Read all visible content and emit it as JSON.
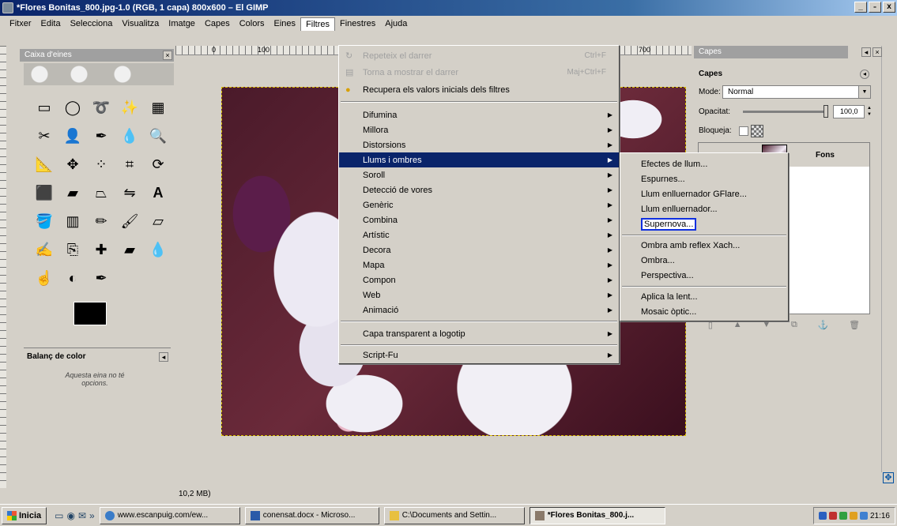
{
  "window": {
    "title": "*Flores Bonitas_800.jpg-1.0 (RGB, 1 capa) 800x600 – El GIMP",
    "buttons": [
      "_",
      "̵",
      "x"
    ]
  },
  "menubar": [
    "Fitxer",
    "Edita",
    "Selecciona",
    "Visualitza",
    "Imatge",
    "Capes",
    "Colors",
    "Eines",
    "Filtres",
    "Finestres",
    "Ajuda"
  ],
  "toolbox": {
    "tab_label": "Caixa d'eines",
    "balance_title": "Balanç de color",
    "balance_text": "Aquesta eina no té opcions."
  },
  "rulers": [
    "0",
    "100",
    "700"
  ],
  "statusbar": "10,2 MB)",
  "filters_menu": {
    "items": [
      {
        "label": "Repeteix el darrer",
        "shortcut": "Ctrl+F",
        "disabled": true
      },
      {
        "label": "Torna a mostrar el darrer",
        "shortcut": "Maj+Ctrl+F",
        "disabled": true
      },
      {
        "label": "Recupera els valors inicials dels filtres",
        "disabled": false
      },
      {
        "label": "Difumina",
        "sub": true
      },
      {
        "label": "Millora",
        "sub": true
      },
      {
        "label": "Distorsions",
        "sub": true
      },
      {
        "label": "Llums i ombres",
        "sub": true,
        "active": true
      },
      {
        "label": "Soroll",
        "sub": true
      },
      {
        "label": "Detecció de vores",
        "sub": true
      },
      {
        "label": "Genèric",
        "sub": true
      },
      {
        "label": "Combina",
        "sub": true
      },
      {
        "label": "Artístic",
        "sub": true
      },
      {
        "label": "Decora",
        "sub": true
      },
      {
        "label": "Mapa",
        "sub": true
      },
      {
        "label": "Compon",
        "sub": true
      },
      {
        "label": "Web",
        "sub": true
      },
      {
        "label": "Animació",
        "sub": true
      },
      {
        "label": "Capa transparent a logotip",
        "sub": true
      },
      {
        "label": "Script-Fu",
        "sub": true
      }
    ]
  },
  "submenu": {
    "items": [
      "Efectes de llum...",
      "Espurnes...",
      "Llum enlluernador GFlare...",
      "Llum enlluernador...",
      "Supernova...",
      "Ombra amb reflex Xach...",
      "Ombra...",
      "Perspectiva...",
      "Aplica la lent...",
      "Mosaic òptic..."
    ]
  },
  "layers": {
    "tab_label": "Capes",
    "title": "Capes",
    "mode_label": "Mode:",
    "mode_value": "Normal",
    "opacity_label": "Opacitat:",
    "opacity_value": "100,0",
    "opacity_fraction": 1.0,
    "lock_label": "Bloqueja:",
    "layer_name": "Fons"
  },
  "taskbar": {
    "start": "Inicia",
    "tasks": [
      "www.escanpuig.com/ew...",
      "conensat.docx - Microso...",
      "C:\\Documents and Settin...",
      "*Flores Bonitas_800.j..."
    ],
    "clock": "21:16"
  }
}
